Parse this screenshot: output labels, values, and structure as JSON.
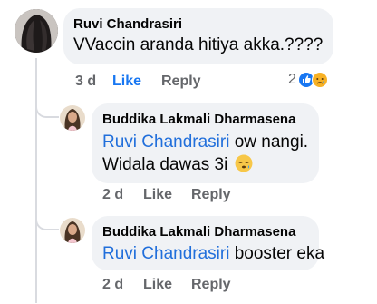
{
  "comments": [
    {
      "author": "Ruvi Chandrasiri",
      "text": "VVaccin aranda hitiya akka.????",
      "time": "3 d",
      "like_label": "Like",
      "reply_label": "Reply",
      "reaction_count": "2",
      "reaction_icons": [
        "like-reaction-icon",
        "sad-reaction-icon"
      ]
    }
  ],
  "replies": [
    {
      "author": "Buddika Lakmali Dharmasena",
      "mention": "Ruvi Chandrasiri",
      "line1_rest": " ow nangi.",
      "line2": "Widala dawas 3i",
      "emoji": "sleepy-face-emoji",
      "time": "2 d",
      "like_label": "Like",
      "reply_label": "Reply"
    },
    {
      "author": "Buddika Lakmali Dharmasena",
      "mention": "Ruvi Chandrasiri",
      "line1_rest": " booster eka",
      "time": "2 d",
      "like_label": "Like",
      "reply_label": "Reply"
    }
  ],
  "colors": {
    "bubble": "#f0f2f5",
    "mention": "#216fdb",
    "like_blue": "#1877f2",
    "meta_gray": "#65676b"
  }
}
